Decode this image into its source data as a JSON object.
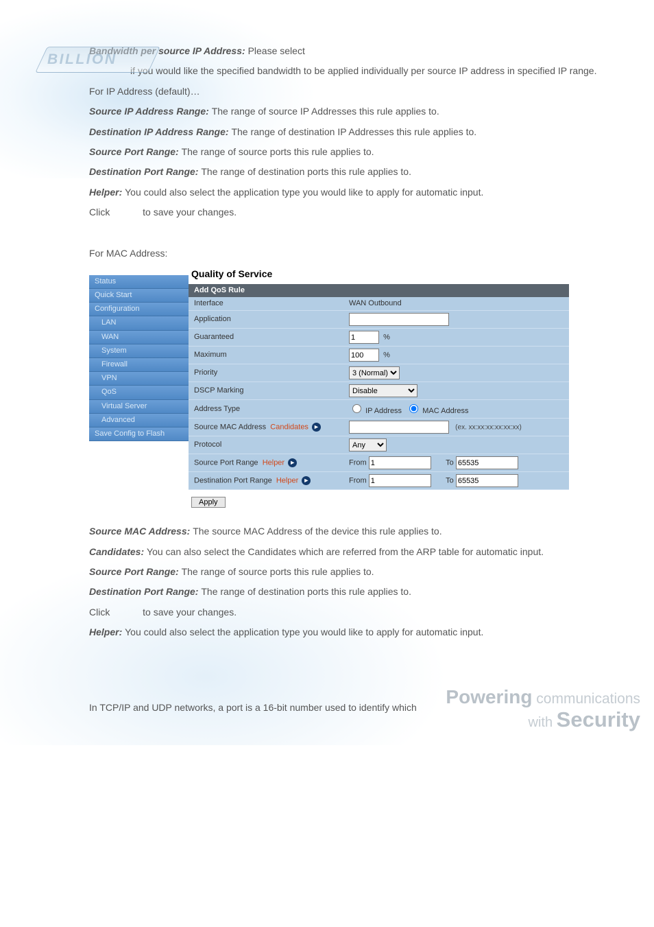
{
  "logo_text": "BILLION",
  "content": {
    "p1a": "Bandwidth per source IP Address: ",
    "p1b": "Please select",
    "p2": "if you would like the specified bandwidth to be applied individually per source IP address in specified IP range.",
    "p3": "For IP Address (default)…",
    "p4a": "Source IP Address Range: ",
    "p4b": "The range of source IP Addresses this rule applies to.",
    "p5a": "Destination IP Address Range: ",
    "p5b": "The range of destination IP Addresses this rule applies to.",
    "p6a": "Source Port Range: ",
    "p6b": "The range of source ports this rule applies to.",
    "p7a": "Destination Port Range: ",
    "p7b": "The range of destination ports this rule applies to.",
    "p8a": "Helper: ",
    "p8b": "You could also select the application type you would like to apply for automatic input.",
    "p9a": "Click ",
    "p9b": " to save your changes.",
    "sec2": "For MAC Address:",
    "p10a": "Source MAC Address: ",
    "p10b": "The source MAC Address of the device this rule applies to.",
    "p11a": "Candidates: ",
    "p11b": "You can also select the Candidates which are referred from the ARP table for automatic input.",
    "p12a": "Source Port Range: ",
    "p12b": "The range of source ports this rule applies to.",
    "p13a": "Destination Port Range: ",
    "p13b": "The range of destination ports this rule applies to.",
    "p14a": "Click ",
    "p14b": " to save your changes.",
    "p15a": "Helper: ",
    "p15b": "You could also select the application type you would like to apply for automatic input.",
    "p16": "In TCP/IP and UDP networks, a port is a 16-bit number used to identify which"
  },
  "ui": {
    "sidebar": {
      "status": "Status",
      "quickstart": "Quick Start",
      "config": "Configuration",
      "lan": "LAN",
      "wan": "WAN",
      "system": "System",
      "firewall": "Firewall",
      "vpn": "VPN",
      "qos": "QoS",
      "virtual": "Virtual Server",
      "advanced": "Advanced",
      "save": "Save Config to Flash"
    },
    "title": "Quality of Service",
    "subtitle": "Add QoS Rule",
    "rows": {
      "interface": "Interface",
      "interface_val": "WAN Outbound",
      "application": "Application",
      "guaranteed": "Guaranteed",
      "guaranteed_val": "1",
      "maximum": "Maximum",
      "maximum_val": "100",
      "percent": "%",
      "priority": "Priority",
      "priority_val": "3 (Normal)",
      "dscp": "DSCP Marking",
      "dscp_val": "Disable",
      "addrtype": "Address Type",
      "addr_ip": "IP Address",
      "addr_mac": "MAC Address",
      "srcmac": "Source MAC Address",
      "candidates": "Candidates",
      "mac_hint": "(ex. xx:xx:xx:xx:xx:xx)",
      "protocol": "Protocol",
      "protocol_val": "Any",
      "srcport": "Source Port Range",
      "dstport": "Destination Port Range",
      "helper": "Helper",
      "from": "From",
      "to": "To",
      "from_val": "1",
      "to_val": "65535"
    },
    "apply": "Apply"
  },
  "tagline": {
    "l1a": "Powering",
    "l1b": " communications",
    "l2a": "with ",
    "l2b": "Security"
  }
}
